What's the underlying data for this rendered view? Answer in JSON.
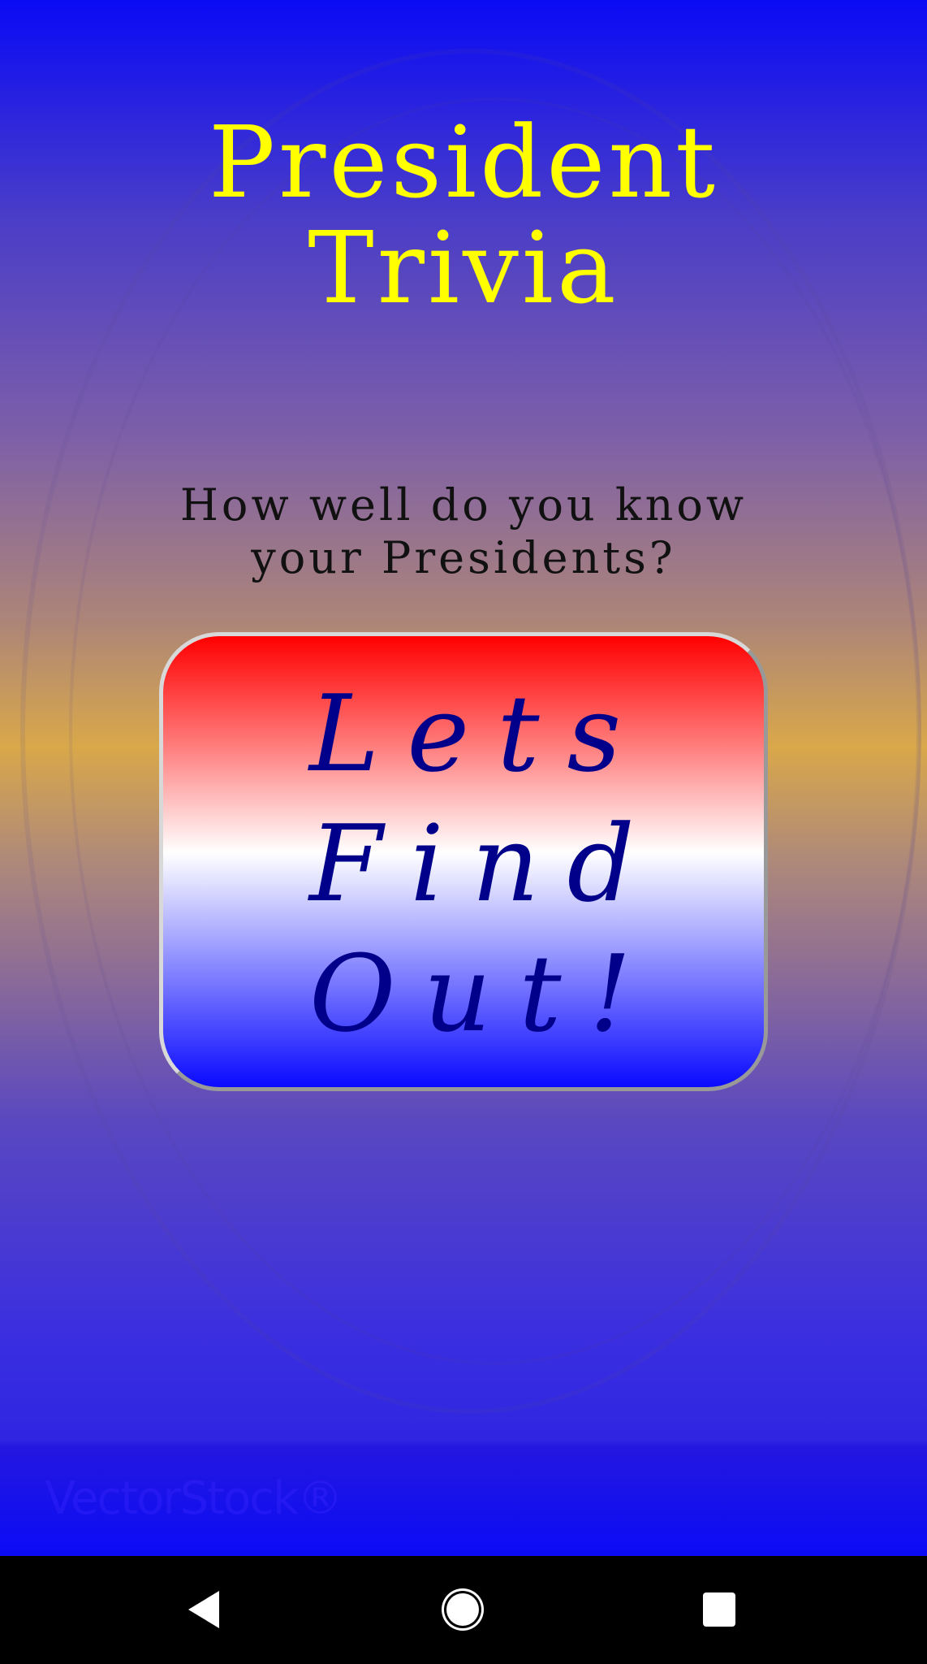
{
  "app": {
    "title_line1": "President",
    "title_line2": "Trivia",
    "subtitle_line1": "How well do you know",
    "subtitle_line2": "your Presidents?",
    "start_button": {
      "line1": "Lets",
      "line2": "Find",
      "line3": "Out!"
    },
    "watermark": "VectorStock®"
  },
  "colors": {
    "title": "#ffff00",
    "button_text": "#00008b",
    "button_gradient": [
      "#ff0000",
      "#ffffff",
      "#0a0aff"
    ],
    "background_top": "#0a0af5",
    "background_mid": "#d9a84a"
  },
  "nav_bar": {
    "icons": [
      "back-icon",
      "home-icon",
      "recent-apps-icon"
    ]
  }
}
